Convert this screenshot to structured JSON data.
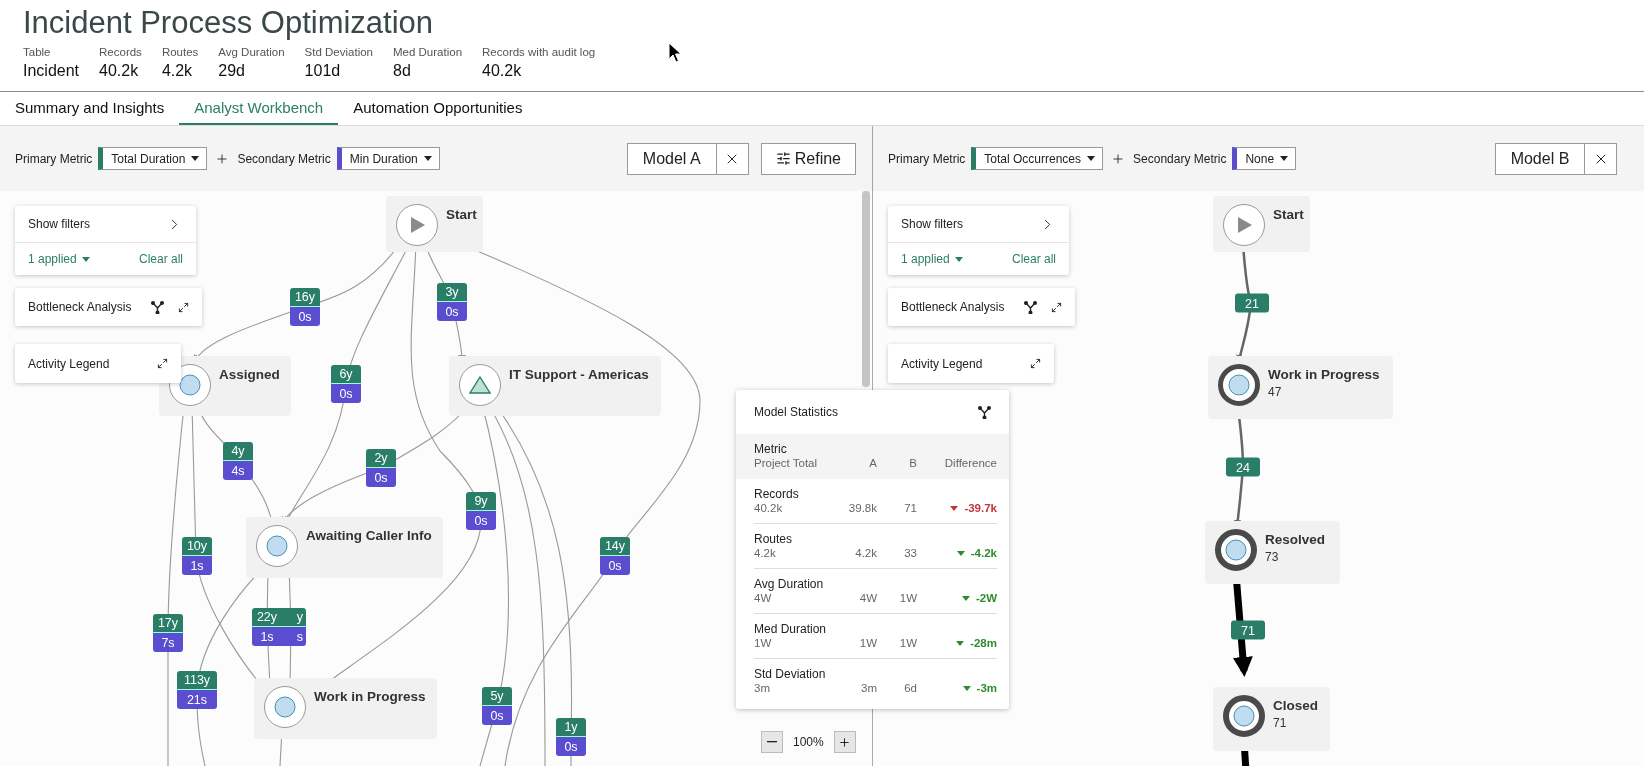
{
  "header": {
    "title": "Incident Process Optimization",
    "stats": [
      {
        "label": "Table",
        "value": "Incident"
      },
      {
        "label": "Records",
        "value": "40.2k"
      },
      {
        "label": "Routes",
        "value": "4.2k"
      },
      {
        "label": "Avg Duration",
        "value": "29d"
      },
      {
        "label": "Std Deviation",
        "value": "101d"
      },
      {
        "label": "Med Duration",
        "value": "8d"
      },
      {
        "label": "Records with audit log",
        "value": "40.2k"
      }
    ]
  },
  "tabs": [
    {
      "label": "Summary and Insights",
      "selected": false
    },
    {
      "label": "Analyst Workbench",
      "selected": true
    },
    {
      "label": "Automation Opportunities",
      "selected": false
    }
  ],
  "panels": [
    {
      "primary_metric": {
        "label": "Primary Metric",
        "value": "Total Duration"
      },
      "secondary_metric": {
        "label": "Secondary Metric",
        "value": "Min Duration"
      },
      "model": "Model A",
      "refine": "Refine",
      "filters": {
        "title": "Show filters",
        "applied": "1 applied",
        "clear": "Clear all"
      },
      "bottleneck": "Bottleneck Analysis",
      "legend": "Activity Legend",
      "nodes": [
        {
          "kind": "start",
          "label": "Start"
        },
        {
          "kind": "activity",
          "label": "Assigned"
        },
        {
          "kind": "group",
          "label": "IT Support - Americas"
        },
        {
          "kind": "activity",
          "label": "Awaiting Caller Info"
        },
        {
          "kind": "activity",
          "label": "Work in Progress"
        }
      ],
      "edge_labels": [
        {
          "primary": "16y",
          "secondary": "0s"
        },
        {
          "primary": "3y",
          "secondary": "0s"
        },
        {
          "primary": "6y",
          "secondary": "0s"
        },
        {
          "primary": "4y",
          "secondary": "4s"
        },
        {
          "primary": "2y",
          "secondary": "0s"
        },
        {
          "primary": "9y",
          "secondary": "0s"
        },
        {
          "primary": "10y",
          "secondary": "1s"
        },
        {
          "primary": "14y",
          "secondary": "0s"
        },
        {
          "primary": "17y",
          "secondary": "7s"
        },
        {
          "primary": "22y",
          "secondary": "1s"
        },
        {
          "primary": "y",
          "secondary": "s"
        },
        {
          "primary": "113y",
          "secondary": "21s"
        },
        {
          "primary": "5y",
          "secondary": "0s"
        },
        {
          "primary": "1y",
          "secondary": "0s"
        }
      ],
      "zoom": "100%",
      "statistics": {
        "title": "Model Statistics",
        "header": {
          "metric": "Metric",
          "total": "Project Total",
          "a": "A",
          "b": "B",
          "difference": "Difference"
        },
        "rows": [
          {
            "metric": "Records",
            "total": "40.2k",
            "a": "39.8k",
            "b": "71",
            "difference": "-39.7k",
            "color": "#c0363c"
          },
          {
            "metric": "Routes",
            "total": "4.2k",
            "a": "4.2k",
            "b": "33",
            "difference": "-4.2k",
            "color": "#2e8b2e"
          },
          {
            "metric": "Avg Duration",
            "total": "4W",
            "a": "4W",
            "b": "1W",
            "difference": "-2W",
            "color": "#2e8b2e"
          },
          {
            "metric": "Med Duration",
            "total": "1W",
            "a": "1W",
            "b": "1W",
            "difference": "-28m",
            "color": "#2e8b2e"
          },
          {
            "metric": "Std Deviation",
            "total": "3m",
            "a": "3m",
            "b": "6d",
            "difference": "-3m",
            "color": "#2e8b2e"
          }
        ]
      }
    },
    {
      "primary_metric": {
        "label": "Primary Metric",
        "value": "Total Occurrences"
      },
      "secondary_metric": {
        "label": "Secondary Metric",
        "value": "None"
      },
      "model": "Model B",
      "filters": {
        "title": "Show filters",
        "applied": "1 applied",
        "clear": "Clear all"
      },
      "bottleneck": "Bottleneck Analysis",
      "legend": "Activity Legend",
      "nodes": [
        {
          "kind": "start",
          "label": "Start"
        },
        {
          "kind": "activity",
          "label": "Work in Progress",
          "count": "47"
        },
        {
          "kind": "activity",
          "label": "Resolved",
          "count": "73"
        },
        {
          "kind": "activity",
          "label": "Closed",
          "count": "71"
        }
      ],
      "edge_labels": [
        {
          "primary": "21"
        },
        {
          "primary": "24"
        },
        {
          "primary": "71"
        }
      ]
    }
  ]
}
